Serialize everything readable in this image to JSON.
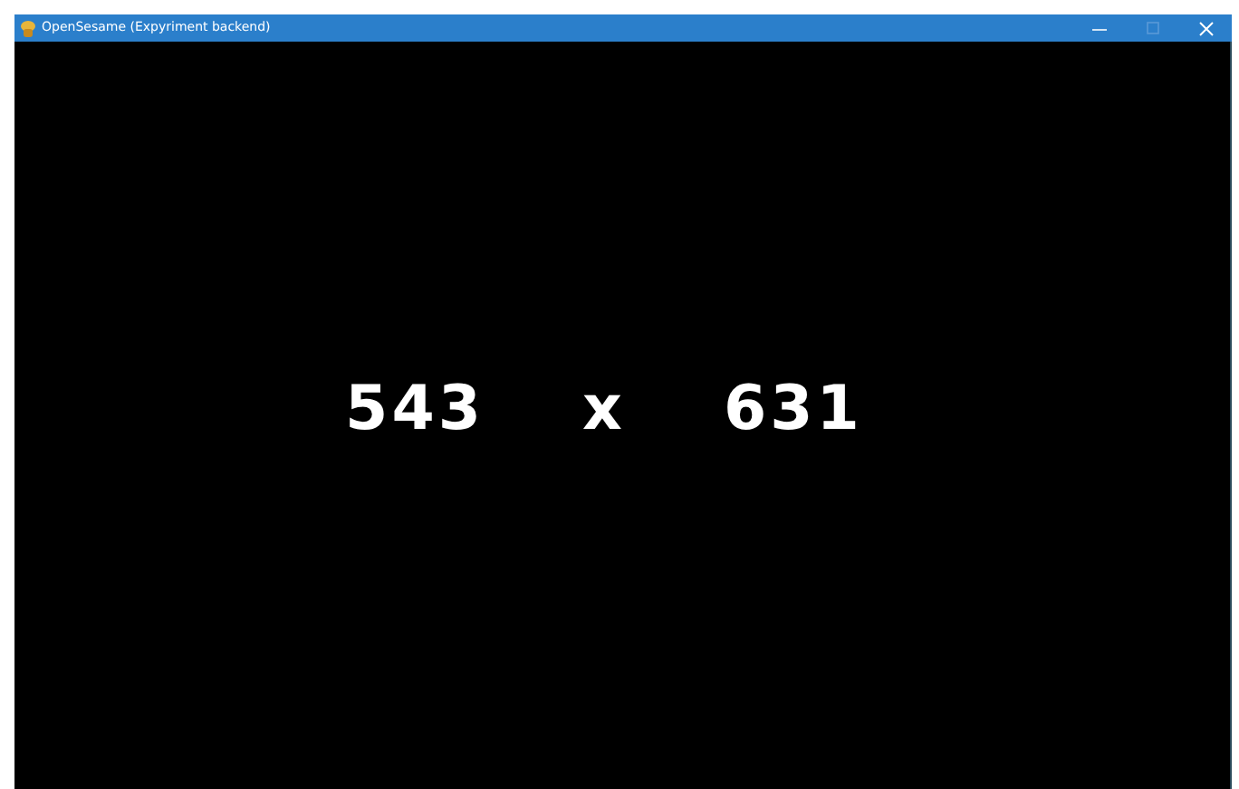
{
  "window": {
    "title": "OpenSesame (Expyriment backend)"
  },
  "display": {
    "terms": [
      "543",
      "x",
      "631"
    ]
  }
}
